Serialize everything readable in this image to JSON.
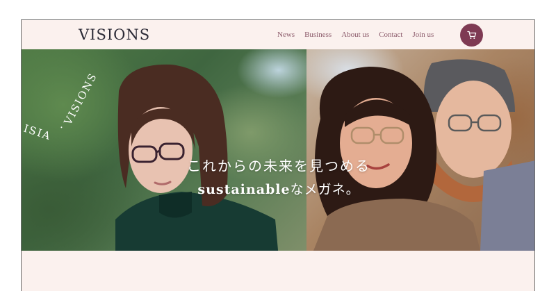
{
  "header": {
    "logo": "VISIONS",
    "nav": [
      {
        "label": "News"
      },
      {
        "label": "Business"
      },
      {
        "label": "About us"
      },
      {
        "label": "Contact"
      },
      {
        "label": "Join us"
      }
    ],
    "cart_icon": "cart-icon"
  },
  "hero": {
    "circular_text": "VISIONS · VISIONS · VISI",
    "tagline_line1": "これからの未来を見つめる",
    "tagline_line2_bold": "sustainable",
    "tagline_line2_rest": "なメガネ。"
  },
  "colors": {
    "accent": "#7e3a53",
    "page_background": "#fbf1ee",
    "nav_text": "#8b5a6a"
  }
}
